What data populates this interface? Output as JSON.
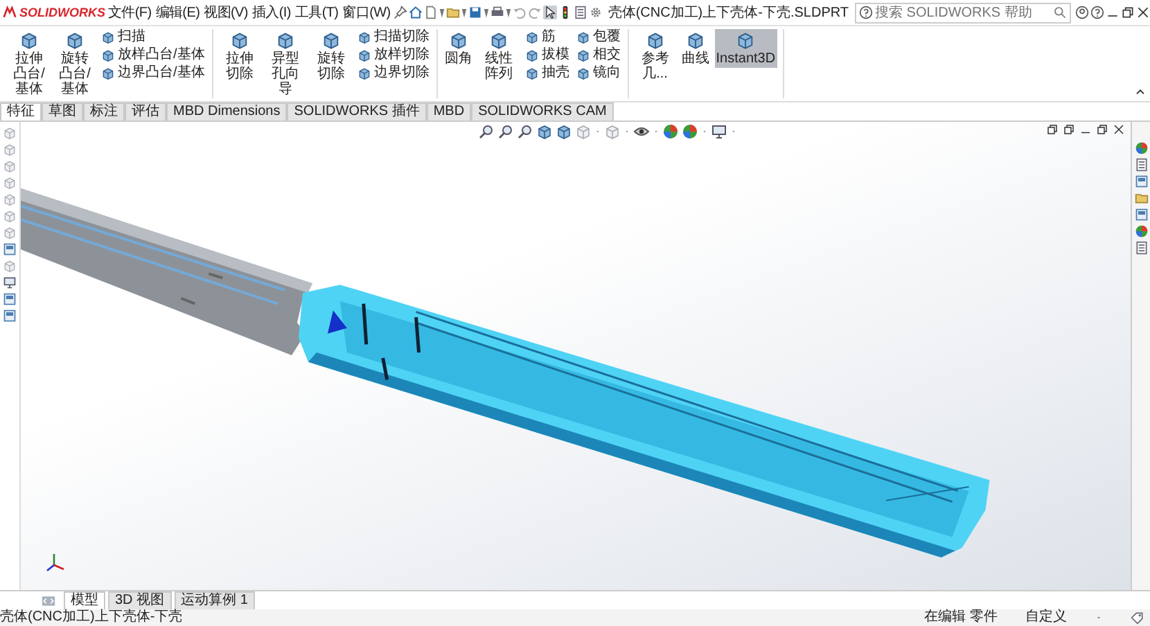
{
  "app": {
    "logo": "SOLIDWORKS"
  },
  "menu": [
    {
      "label": "文件(F)"
    },
    {
      "label": "编辑(E)"
    },
    {
      "label": "视图(V)"
    },
    {
      "label": "插入(I)"
    },
    {
      "label": "工具(T)"
    },
    {
      "label": "窗口(W)"
    }
  ],
  "quick_access": {
    "select_selected": true
  },
  "title": "壳体(CNC加工)上下壳体-下壳.SLDPRT",
  "search": {
    "placeholder": "搜索 SOLIDWORKS 帮助"
  },
  "ribbon": [
    {
      "items": [
        {
          "kind": "large",
          "label": "拉伸凸台/基体",
          "on": false
        },
        {
          "kind": "large",
          "label": "旋转凸台/基体",
          "on": false
        },
        {
          "kind": "small",
          "label": "扫描",
          "on": false
        },
        {
          "kind": "small",
          "label": "放样凸台/基体",
          "on": false
        },
        {
          "kind": "small",
          "label": "边界凸台/基体",
          "on": false
        }
      ]
    },
    {
      "items": [
        {
          "kind": "large",
          "label": "拉伸切除",
          "on": false
        },
        {
          "kind": "large",
          "label": "异型孔向导",
          "on": false
        },
        {
          "kind": "large",
          "label": "旋转切除",
          "on": false
        },
        {
          "kind": "small",
          "label": "扫描切除",
          "on": false
        },
        {
          "kind": "small",
          "label": "放样切除",
          "on": false
        },
        {
          "kind": "small",
          "label": "边界切除",
          "on": false
        }
      ]
    },
    {
      "items": [
        {
          "kind": "large",
          "label": "圆角",
          "on": false
        },
        {
          "kind": "large",
          "label": "线性阵列",
          "on": false
        },
        {
          "kind": "small",
          "label": "筋",
          "on": false
        },
        {
          "kind": "small",
          "label": "拔模",
          "on": false
        },
        {
          "kind": "small",
          "label": "抽壳",
          "on": false
        },
        {
          "kind": "small",
          "label": "包覆",
          "on": false
        },
        {
          "kind": "small",
          "label": "相交",
          "on": false
        },
        {
          "kind": "small",
          "label": "镜向",
          "on": false
        }
      ]
    },
    {
      "items": [
        {
          "kind": "large",
          "label": "参考几...",
          "on": false
        },
        {
          "kind": "large",
          "label": "曲线",
          "on": false
        },
        {
          "kind": "large",
          "label": "Instant3D",
          "on": true
        }
      ]
    }
  ],
  "command_tabs": [
    {
      "label": "特征",
      "selected": true
    },
    {
      "label": "草图",
      "selected": false
    },
    {
      "label": "标注",
      "selected": false
    },
    {
      "label": "评估",
      "selected": false
    },
    {
      "label": "MBD Dimensions",
      "selected": false
    },
    {
      "label": "SOLIDWORKS 插件",
      "selected": false
    },
    {
      "label": "MBD",
      "selected": false
    },
    {
      "label": "SOLIDWORKS CAM",
      "selected": false
    }
  ],
  "bottom_tabs": [
    {
      "label": "模型",
      "selected": true
    },
    {
      "label": "3D 视图",
      "selected": false
    },
    {
      "label": "运动算例 1",
      "selected": false
    }
  ],
  "status_bar": {
    "document": "壳体(CNC加工)上下壳体-下壳",
    "mode": "在编辑 零件",
    "units": "自定义"
  }
}
